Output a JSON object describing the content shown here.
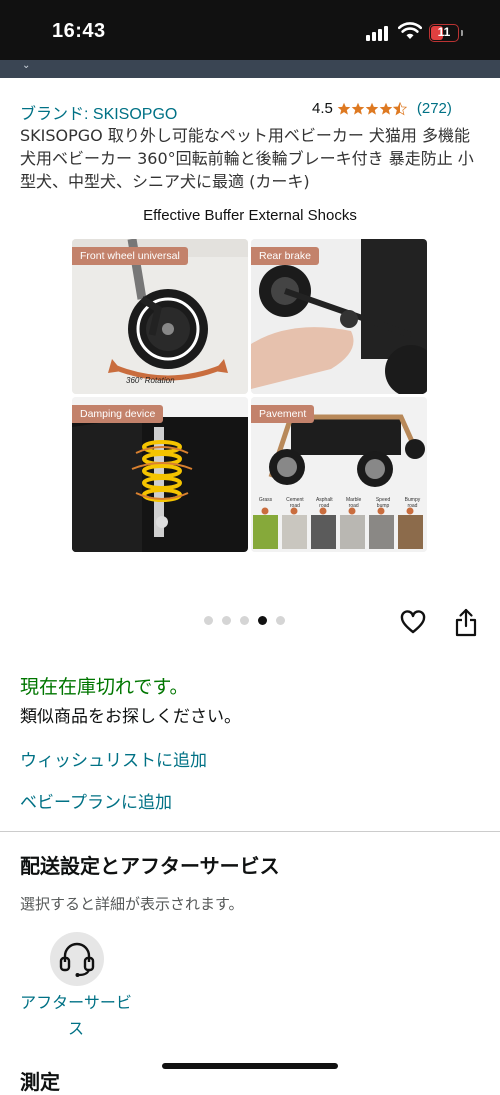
{
  "status_bar": {
    "time": "16:43",
    "battery_level": "11",
    "signal_icon": "cellular-signal-icon",
    "wifi_icon": "wifi-icon"
  },
  "product": {
    "brand_link": "ブランド: SKISOPGO",
    "rating": "4.5",
    "stars_value": 4.5,
    "rating_count": "(272)",
    "title": "SKISOPGO 取り外し可能なペット用ベビーカー 犬猫用 多機能犬用ベビーカー 360°回転前輪と後輪ブレーキ付き 暴走防止 小型犬、中型犬、シニア犬に最適 (カーキ)"
  },
  "hero_image": {
    "heading": "Effective Buffer External Shocks",
    "tiles": [
      {
        "label": "Front wheel universal",
        "caption": "360° Rotation"
      },
      {
        "label": "Rear brake"
      },
      {
        "label": "Damping device"
      },
      {
        "label": "Pavement",
        "surfaces": [
          "Grass",
          "Cement road",
          "Asphalt road",
          "Marble road",
          "Speed bump",
          "Bumpy road"
        ]
      }
    ],
    "carousel_total": 5,
    "carousel_active_index": 3
  },
  "actions": {
    "heart_icon": "heart-icon",
    "share_icon": "share-icon"
  },
  "availability": {
    "status": "現在在庫切れです。",
    "message": "類似商品をお探しください。"
  },
  "links": {
    "wishlist": "ウィッシュリストに追加",
    "baby_plan": "ベビープランに追加"
  },
  "delivery": {
    "title": "配送設定とアフターサービス",
    "subtitle": "選択すると詳細が表示されます。",
    "support_label": "アフターサービス",
    "support_icon": "headset-icon",
    "next_section_partial": "測定"
  },
  "colors": {
    "link": "#007185",
    "in_stock_green": "#007600",
    "star": "#de7921",
    "label_bg": "#c3826b"
  }
}
